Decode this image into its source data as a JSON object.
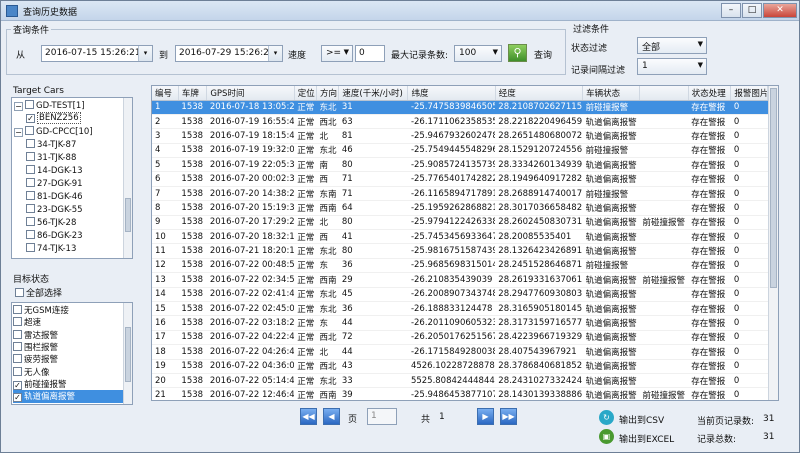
{
  "window": {
    "title": "查询历史数据",
    "minimize": "–",
    "maximize": "□",
    "close": "✕"
  },
  "query": {
    "group_label": "查询条件",
    "from_label": "从",
    "from_value": "2016-07-15 15:26:21",
    "to_label": "到",
    "to_value": "2016-07-29 15:26:21",
    "speed_label": "速度",
    "speed_op": ">=",
    "speed_value": "0",
    "max_label": "最大记录条数:",
    "max_value": "100",
    "query_label": "查询"
  },
  "filter": {
    "group_label": "过滤条件",
    "status_label": "状态过滤",
    "status_value": "全部",
    "interval_label": "记录间隔过滤",
    "interval_value": "1"
  },
  "target": {
    "label": "Target Cars",
    "items": [
      {
        "label": "GD-TEST[1]",
        "expander": "−",
        "checked": false
      },
      {
        "label": "BENZ256",
        "checked": true
      },
      {
        "label": "GD-CPCC[10]",
        "expander": "−",
        "checked": false
      },
      {
        "label": "34-TJK-87",
        "checked": false
      },
      {
        "label": "31-TJK-88",
        "checked": false
      },
      {
        "label": "14-DGK-13",
        "checked": false
      },
      {
        "label": "27-DGK-91",
        "checked": false
      },
      {
        "label": "81-DGK-46",
        "checked": false
      },
      {
        "label": "23-DGK-55",
        "checked": false
      },
      {
        "label": "56-TJK-28",
        "checked": false
      },
      {
        "label": "86-DGK-23",
        "checked": false
      },
      {
        "label": "74-TJK-13",
        "checked": false
      }
    ]
  },
  "status_section": {
    "label": "目标状态",
    "select_all": "全部选择",
    "items": [
      {
        "label": "无GSM连接",
        "checked": false
      },
      {
        "label": "超速",
        "checked": false
      },
      {
        "label": "雷达报警",
        "checked": false
      },
      {
        "label": "围栏报警",
        "checked": false
      },
      {
        "label": "疲劳报警",
        "checked": false
      },
      {
        "label": "无人像",
        "checked": false
      },
      {
        "label": "前碰撞报警",
        "checked": true
      },
      {
        "label": "轨道偏离报警",
        "checked": true,
        "selected": true
      }
    ]
  },
  "table": {
    "columns": [
      "编号",
      "车牌",
      "GPS时间",
      "定位",
      "方向",
      "速度(千米/小时)",
      "纬度",
      "经度",
      "车辆状态",
      "",
      "状态处理",
      "报警图片"
    ],
    "rows": [
      [
        "1",
        "1538",
        "2016-07-18 13:05:24",
        "正常",
        "东北",
        "31",
        "-25.7475839846505",
        "28.2108702627115",
        "前碰撞报警",
        "",
        "存在警报",
        "0"
      ],
      [
        "2",
        "1538",
        "2016-07-19 16:55:41",
        "正常",
        "西北",
        "63",
        "-26.1711062358535",
        "28.2218220496459",
        "轨道偏离报警",
        "",
        "存在警报",
        "0"
      ],
      [
        "3",
        "1538",
        "2016-07-19 18:15:44",
        "正常",
        "北",
        "81",
        "-25.9467932602478",
        "28.2651480680072",
        "轨道偏离报警",
        "",
        "存在警报",
        "0"
      ],
      [
        "4",
        "1538",
        "2016-07-19 19:32:00",
        "正常",
        "东北",
        "46",
        "-25.7549445548296",
        "28.1529120724556",
        "前碰撞报警",
        "",
        "存在警报",
        "0"
      ],
      [
        "5",
        "1538",
        "2016-07-19 22:05:39",
        "正常",
        "南",
        "80",
        "-25.9085724135739",
        "28.3334260134939",
        "轨道偏离报警",
        "",
        "存在警报",
        "0"
      ],
      [
        "6",
        "1538",
        "2016-07-20 00:02:37",
        "正常",
        "西",
        "71",
        "-25.7765401742822",
        "28.1949640917282",
        "轨道偏离报警",
        "",
        "存在警报",
        "0"
      ],
      [
        "7",
        "1538",
        "2016-07-20 14:38:21",
        "正常",
        "东南",
        "71",
        "-26.1165894717891",
        "28.2688914740017",
        "前碰撞报警",
        "",
        "存在警报",
        "0"
      ],
      [
        "8",
        "1538",
        "2016-07-20 15:19:38",
        "正常",
        "西南",
        "64",
        "-25.1959262868821",
        "28.3017036658482",
        "轨道偏离报警",
        "",
        "存在警报",
        "0"
      ],
      [
        "9",
        "1538",
        "2016-07-20 17:29:26",
        "正常",
        "北",
        "80",
        "-25.9794122426338",
        "28.2602450830731",
        "轨道偏离报警",
        "前碰撞报警",
        "存在警报",
        "0"
      ],
      [
        "10",
        "1538",
        "2016-07-20 18:32:13",
        "正常",
        "西",
        "41",
        "-25.7453456933647",
        "28.20085535401",
        "轨道偏离报警",
        "",
        "存在警报",
        "0"
      ],
      [
        "11",
        "1538",
        "2016-07-21 18:20:13",
        "正常",
        "东北",
        "80",
        "-25.9816751587439",
        "28.1326423426891",
        "轨道偏离报警",
        "",
        "存在警报",
        "0"
      ],
      [
        "12",
        "1538",
        "2016-07-22 00:48:51",
        "正常",
        "东",
        "36",
        "-25.9685698315014",
        "28.2451528646871",
        "前碰撞报警",
        "",
        "存在警报",
        "0"
      ],
      [
        "13",
        "1538",
        "2016-07-22 02:34:51",
        "正常",
        "西南",
        "29",
        "-26.210835439039",
        "28.2619331637061",
        "轨道偏离报警",
        "前碰撞报警",
        "存在警报",
        "0"
      ],
      [
        "14",
        "1538",
        "2016-07-22 02:41:41",
        "正常",
        "东北",
        "45",
        "-26.2008907343748",
        "28.2947760930803",
        "轨道偏离报警",
        "",
        "存在警报",
        "0"
      ],
      [
        "15",
        "1538",
        "2016-07-22 02:45:06",
        "正常",
        "东北",
        "36",
        "-26.188833124478",
        "28.3165905180145",
        "轨道偏离报警",
        "",
        "存在警报",
        "0"
      ],
      [
        "16",
        "1538",
        "2016-07-22 03:18:24",
        "正常",
        "东",
        "44",
        "-26.2011090605323",
        "28.3173159716577",
        "轨道偏离报警",
        "",
        "存在警报",
        "0"
      ],
      [
        "17",
        "1538",
        "2016-07-22 04:22:49",
        "正常",
        "西北",
        "72",
        "-26.2050176251567",
        "28.4223966719329",
        "轨道偏离报警",
        "",
        "存在警报",
        "0"
      ],
      [
        "18",
        "1538",
        "2016-07-22 04:26:47",
        "正常",
        "北",
        "44",
        "-26.1715849280038",
        "28.407543967921",
        "轨道偏离报警",
        "",
        "存在警报",
        "0"
      ],
      [
        "19",
        "1538",
        "2016-07-22 04:36:02",
        "正常",
        "西北",
        "43",
        "4526.1022872887826",
        "28.3786840681852",
        "轨道偏离报警",
        "",
        "存在警报",
        "0"
      ],
      [
        "20",
        "1538",
        "2016-07-22 05:14:46",
        "正常",
        "东北",
        "33",
        "5525.8084244484461",
        "28.2431027332424",
        "轨道偏离报警",
        "",
        "存在警报",
        "0"
      ],
      [
        "21",
        "1538",
        "2016-07-22 12:46:48",
        "正常",
        "西南",
        "39",
        "-25.9486453877107",
        "28.1430139338886",
        "轨道偏离报警",
        "前碰撞报警",
        "存在警报",
        "0"
      ]
    ],
    "selected_row": 0
  },
  "pager": {
    "page_label": "页",
    "page_value": "1",
    "total_label": "共",
    "total_value": "1"
  },
  "export": {
    "csv": "输出到CSV",
    "excel": "输出到EXCEL"
  },
  "summary": {
    "current_label": "当前页记录数:",
    "current_value": "31",
    "total_label": "记录总数:",
    "total_value": "31"
  }
}
